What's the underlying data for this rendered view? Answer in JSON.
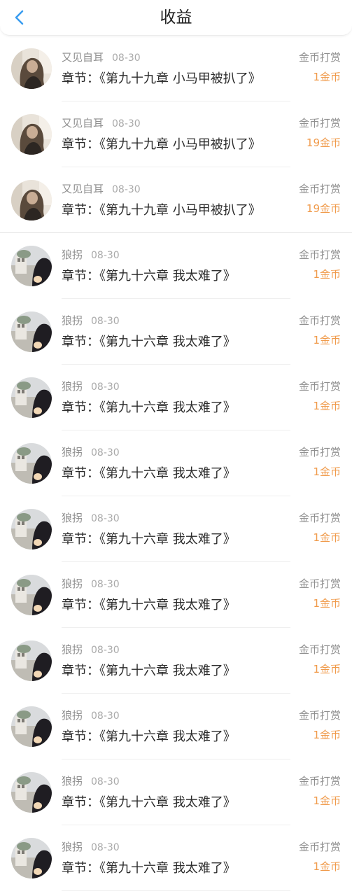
{
  "header": {
    "title": "收益",
    "back_icon": "chevron-left-icon",
    "accent": "#3a9df0"
  },
  "colors": {
    "amount": "#f09a4a",
    "meta": "#8f8f8f",
    "text": "#2b2b2b"
  },
  "rows": [
    {
      "user": "又见自耳",
      "date": "08-30",
      "chapter": "章节：《第九十九章  小马甲被扒了》",
      "type": "金币打赏",
      "amount": "1金币",
      "avatar": "avatar-woman-icon"
    },
    {
      "user": "又见自耳",
      "date": "08-30",
      "chapter": "章节：《第九十九章  小马甲被扒了》",
      "type": "金币打赏",
      "amount": "19金币",
      "avatar": "avatar-woman-icon"
    },
    {
      "user": "又见自耳",
      "date": "08-30",
      "chapter": "章节：《第九十九章  小马甲被扒了》",
      "type": "金币打赏",
      "amount": "19金币",
      "avatar": "avatar-woman-icon"
    },
    {
      "user": "狼拐",
      "date": "08-30",
      "chapter": "章节：《第九十六章   我太难了》",
      "type": "金币打赏",
      "amount": "1金币",
      "avatar": "avatar-street-icon"
    },
    {
      "user": "狼拐",
      "date": "08-30",
      "chapter": "章节：《第九十六章   我太难了》",
      "type": "金币打赏",
      "amount": "1金币",
      "avatar": "avatar-street-icon"
    },
    {
      "user": "狼拐",
      "date": "08-30",
      "chapter": "章节：《第九十六章   我太难了》",
      "type": "金币打赏",
      "amount": "1金币",
      "avatar": "avatar-street-icon"
    },
    {
      "user": "狼拐",
      "date": "08-30",
      "chapter": "章节：《第九十六章   我太难了》",
      "type": "金币打赏",
      "amount": "1金币",
      "avatar": "avatar-street-icon"
    },
    {
      "user": "狼拐",
      "date": "08-30",
      "chapter": "章节：《第九十六章   我太难了》",
      "type": "金币打赏",
      "amount": "1金币",
      "avatar": "avatar-street-icon"
    },
    {
      "user": "狼拐",
      "date": "08-30",
      "chapter": "章节：《第九十六章   我太难了》",
      "type": "金币打赏",
      "amount": "1金币",
      "avatar": "avatar-street-icon"
    },
    {
      "user": "狼拐",
      "date": "08-30",
      "chapter": "章节：《第九十六章   我太难了》",
      "type": "金币打赏",
      "amount": "1金币",
      "avatar": "avatar-street-icon"
    },
    {
      "user": "狼拐",
      "date": "08-30",
      "chapter": "章节：《第九十六章   我太难了》",
      "type": "金币打赏",
      "amount": "1金币",
      "avatar": "avatar-street-icon"
    },
    {
      "user": "狼拐",
      "date": "08-30",
      "chapter": "章节：《第九十六章   我太难了》",
      "type": "金币打赏",
      "amount": "1金币",
      "avatar": "avatar-street-icon"
    },
    {
      "user": "狼拐",
      "date": "08-30",
      "chapter": "章节：《第九十六章   我太难了》",
      "type": "金币打赏",
      "amount": "1金币",
      "avatar": "avatar-street-icon"
    }
  ]
}
